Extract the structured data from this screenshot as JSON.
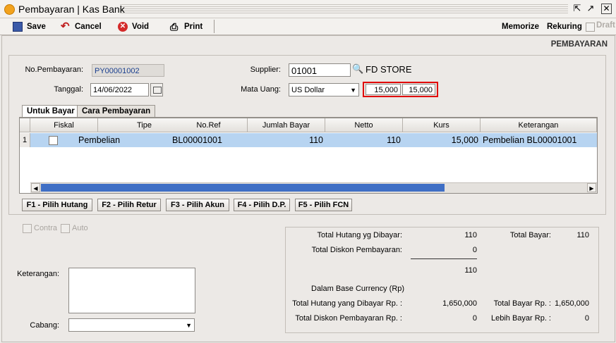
{
  "window": {
    "title": "Pembayaran | Kas Bank"
  },
  "toolbar": {
    "save": "Save",
    "cancel": "Cancel",
    "void": "Void",
    "print": "Print",
    "memorize": "Memorize",
    "rekuring": "Rekuring",
    "draft": "Draft"
  },
  "heading": "PEMBAYARAN",
  "form": {
    "no_label": "No.Pembayaran:",
    "no_value": "PY00001002",
    "tanggal_label": "Tanggal:",
    "tanggal_value": "14/06/2022",
    "supplier_label": "Supplier:",
    "supplier_code": "01001",
    "supplier_name": "FD STORE",
    "matauang_label": "Mata Uang:",
    "matauang_value": "US Dollar",
    "rate1": "15,000",
    "rate2": "15,000"
  },
  "tabs": [
    "Untuk Bayar",
    "Cara Pembayaran"
  ],
  "grid": {
    "columns": [
      "Fiskal",
      "Tipe",
      "No.Ref",
      "Jumlah Bayar",
      "Netto",
      "Kurs",
      "Keterangan"
    ],
    "rows": [
      {
        "num": "1",
        "tipe": "Pembelian",
        "noref": "BL00001001",
        "jumlah": "110",
        "netto": "110",
        "kurs": "15,000",
        "keterangan": "Pembelian BL00001001"
      }
    ]
  },
  "fbuttons": [
    "F1 - Pilih Hutang",
    "F2 - Pilih Retur",
    "F3 - Pilih Akun",
    "F4 - Pilih D.P.",
    "F5 - Pilih FCN"
  ],
  "options": {
    "contra": "Contra",
    "auto": "Auto"
  },
  "notes": {
    "keterangan_label": "Keterangan:",
    "cabang_label": "Cabang:"
  },
  "summary": {
    "total_hutang_label": "Total Hutang yg Dibayar:",
    "total_hutang": "110",
    "total_bayar_label": "Total Bayar:",
    "total_bayar": "110",
    "total_diskon_label": "Total Diskon Pembayaran:",
    "total_diskon": "0",
    "subtotal": "110",
    "base_label": "Dalam Base Currency (Rp)",
    "hutang_rp_label": "Total Hutang yang Dibayar Rp. :",
    "hutang_rp": "1,650,000",
    "bayar_rp_label": "Total Bayar Rp. :",
    "bayar_rp": "1,650,000",
    "diskon_rp_label": "Total Diskon Pembayaran Rp. :",
    "diskon_rp": "0",
    "lebih_label": "Lebih Bayar Rp. :",
    "lebih": "0"
  },
  "colors": {
    "selected_row": "#b7d4f1",
    "highlight": "#e00000",
    "scroll_thumb": "#3f6fc5"
  }
}
